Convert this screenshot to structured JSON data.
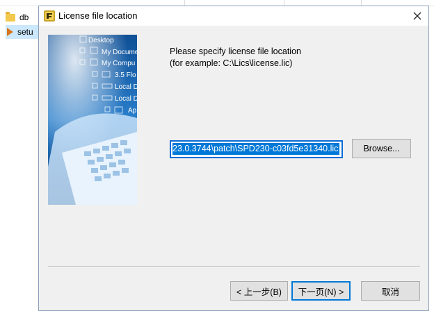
{
  "explorer": {
    "items": [
      {
        "label": "db",
        "icon": "folder-icon"
      },
      {
        "label": "setu",
        "icon": "play-icon"
      }
    ]
  },
  "dialog": {
    "title": "License file location",
    "prompt_line1": "Please specify license file location",
    "prompt_line2": "(for example: C:\\Lics\\license.lic)",
    "path_value": "23.0.3744\\patch\\SPD230-c03fd5e31340.lic",
    "browse_label": "Browse...",
    "back_label": "< 上一步(B)",
    "next_label": "下一页(N) >",
    "cancel_label": "取消"
  },
  "banner": {
    "tree": [
      "Desktop",
      "My Docume",
      "My Compu",
      "3.5 Flo",
      "Local D",
      "Local D",
      "Ap"
    ]
  },
  "colors": {
    "accent": "#0078d7",
    "dialog_bg": "#f0f0f0",
    "banner_blue": "#1b66b0"
  }
}
